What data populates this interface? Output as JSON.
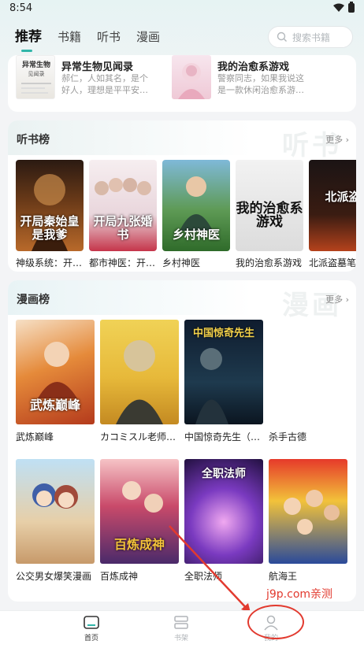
{
  "status": {
    "time": "8:54"
  },
  "header": {
    "tabs": [
      {
        "label": "推荐",
        "active": true
      },
      {
        "label": "书籍",
        "active": false
      },
      {
        "label": "听书",
        "active": false
      },
      {
        "label": "漫画",
        "active": false
      }
    ],
    "search_placeholder": "搜索书籍"
  },
  "top_list": {
    "items": [
      {
        "title": "异常生物见闻录",
        "desc": "郝仁，人如其名，是个好人，理想是平平安…"
      },
      {
        "title": "我的治愈系游戏",
        "desc": "警察同志，如果我说这是一款休闲治愈系游…"
      }
    ]
  },
  "audio_section": {
    "title": "听书榜",
    "more": "更多",
    "watermark": "听书",
    "items": [
      {
        "title": "神级系统：开…",
        "cover_text": "开局秦始皇是我爹"
      },
      {
        "title": "都市神医：开…",
        "cover_text": "开局九张婚书"
      },
      {
        "title": "乡村神医",
        "cover_text": "乡村神医"
      },
      {
        "title": "我的治愈系游戏",
        "cover_text": "我的治愈系游戏"
      },
      {
        "title": "北派盗墓笔",
        "cover_text": "北派盗"
      }
    ]
  },
  "comic_section": {
    "title": "漫画榜",
    "more": "更多",
    "watermark": "漫画",
    "items": [
      {
        "title": "武炼巅峰",
        "cover_text": "武炼巅峰"
      },
      {
        "title": "カコミスル老师…",
        "cover_text": ""
      },
      {
        "title": "中国惊奇先生（…",
        "cover_text": "中国惊奇先生"
      },
      {
        "title": "杀手古德",
        "cover_text": ""
      },
      {
        "title": "公交男女爆笑漫画",
        "cover_text": ""
      },
      {
        "title": "百炼成神",
        "cover_text": "百炼成神"
      },
      {
        "title": "全职法师",
        "cover_text": "全职法师"
      },
      {
        "title": "航海王",
        "cover_text": ""
      }
    ]
  },
  "overlay": {
    "site_mark": "j9p.com亲测",
    "mark_color": "#e23a2f"
  },
  "bottom_nav": {
    "items": [
      {
        "label": "首页",
        "icon": "home-icon",
        "active": true
      },
      {
        "label": "书架",
        "icon": "bookshelf-icon",
        "active": false
      },
      {
        "label": "我的",
        "icon": "user-icon",
        "active": false
      }
    ]
  },
  "colors": {
    "accent": "#31b6a9"
  }
}
